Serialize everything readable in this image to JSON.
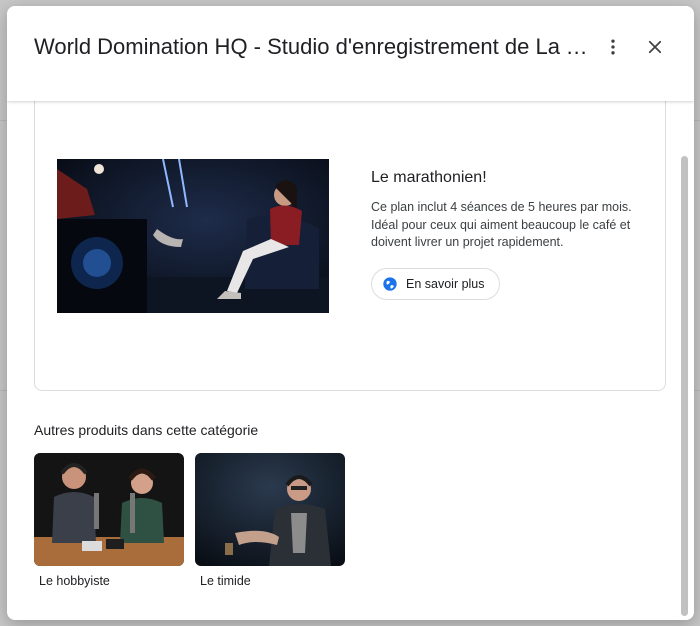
{
  "dialog": {
    "title": "World Domination HQ - Studio d'enregistrement de La Trappe"
  },
  "plan": {
    "title": "Le marathonien!",
    "description": "Ce plan inclut 4 séances de 5 heures par mois. Idéal pour ceux qui aiment beaucoup le café et doivent livrer un projet rapidement.",
    "button_label": "En savoir plus",
    "button_icon": "globe-icon"
  },
  "other_products": {
    "section_title": "Autres produits dans cette catégorie",
    "items": [
      {
        "label": "Le hobbyiste"
      },
      {
        "label": "Le timide"
      }
    ]
  },
  "colors": {
    "accent": "#1a73e8",
    "text": "#202124",
    "border": "#dadce0"
  }
}
